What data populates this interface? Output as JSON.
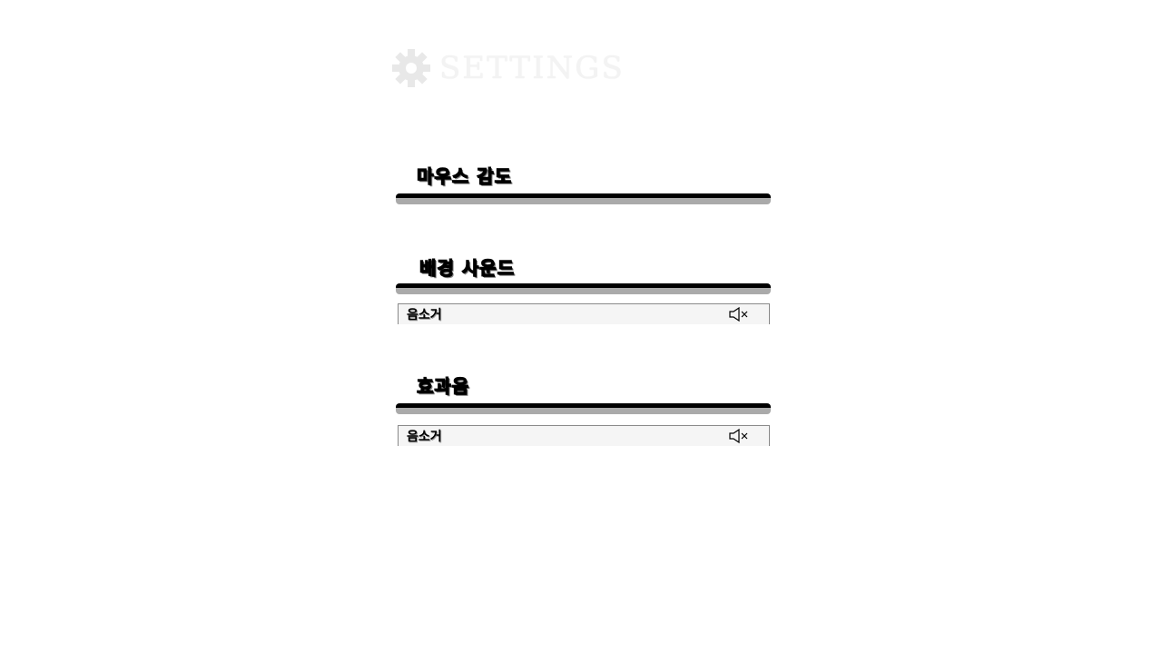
{
  "header": {
    "title": "SETTINGS",
    "icon": "gear-icon",
    "color": "#eeeeee"
  },
  "sections": [
    {
      "label": "마우스 감도"
    },
    {
      "label": "배경 사운드",
      "mute_label": "음소거",
      "mute_icon": "speaker-muted-icon"
    },
    {
      "label": "효과음",
      "mute_label": "음소거",
      "mute_icon": "speaker-muted-icon"
    }
  ]
}
